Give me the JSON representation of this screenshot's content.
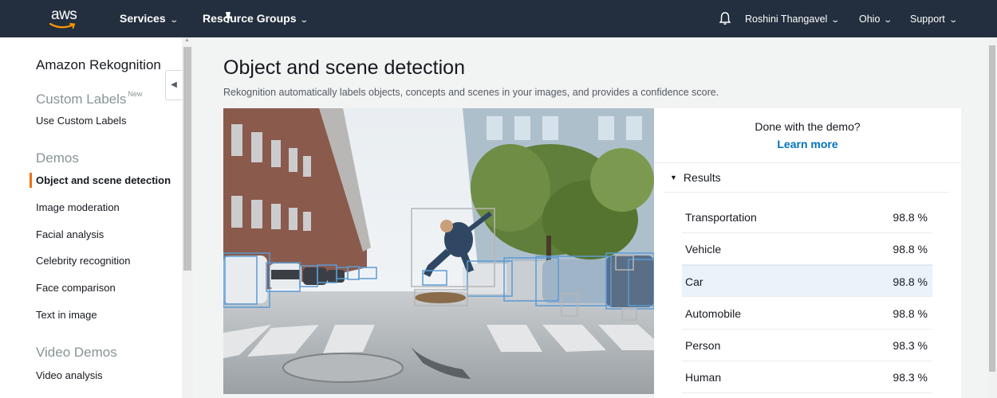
{
  "topbar": {
    "logo_text": "aws",
    "services": "Services",
    "resource_groups": "Resource Groups",
    "user": "Roshini Thangavel",
    "region": "Ohio",
    "support": "Support"
  },
  "sidebar": {
    "title": "Amazon Rekognition",
    "custom_labels_head": "Custom Labels",
    "new_badge": "New",
    "use_custom_labels": "Use Custom Labels",
    "demos_head": "Demos",
    "demos": [
      "Object and scene detection",
      "Image moderation",
      "Facial analysis",
      "Celebrity recognition",
      "Face comparison",
      "Text in image"
    ],
    "video_demos_head": "Video Demos",
    "video_analysis": "Video analysis"
  },
  "main": {
    "title": "Object and scene detection",
    "subtitle": "Rekognition automatically labels objects, concepts and scenes in your images, and provides a confidence score."
  },
  "panel": {
    "done_text": "Done with the demo?",
    "learn_more": "Learn more",
    "results_label": "Results",
    "results": [
      {
        "label": "Transportation",
        "value": "98.8 %"
      },
      {
        "label": "Vehicle",
        "value": "98.8 %"
      },
      {
        "label": "Car",
        "value": "98.8 %",
        "highlighted": true
      },
      {
        "label": "Automobile",
        "value": "98.8 %"
      },
      {
        "label": "Person",
        "value": "98.3 %"
      },
      {
        "label": "Human",
        "value": "98.3 %"
      }
    ]
  },
  "colors": {
    "nav_bg": "#232f3e",
    "active_accent": "#ec7211",
    "link": "#0073bb",
    "bbox_blue": "#5b9bd5",
    "row_highlight": "#eaf3fa"
  }
}
